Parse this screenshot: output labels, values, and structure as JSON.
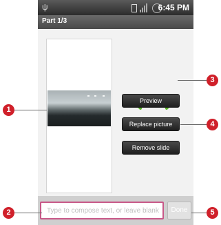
{
  "status_bar": {
    "usb_icon": "usb-icon",
    "time": "6:45 PM"
  },
  "title_bar": {
    "title": "Part 1/3"
  },
  "slide": {
    "image_icon": "photo-thumbnail"
  },
  "navigation": {
    "prev_icon": "chevron-left-icon",
    "next_icon": "chevron-right-icon",
    "arrow_color": "#5cb52a"
  },
  "buttons": {
    "preview": "Preview",
    "replace_picture": "Replace picture",
    "remove_slide": "Remove slide"
  },
  "compose": {
    "placeholder": "Type to compose text, or leave blank"
  },
  "done_button": {
    "label": "Done"
  },
  "callouts": [
    "1",
    "2",
    "3",
    "4",
    "5"
  ],
  "colors": {
    "callout": "#d0202a",
    "compose_border": "#c85888"
  }
}
